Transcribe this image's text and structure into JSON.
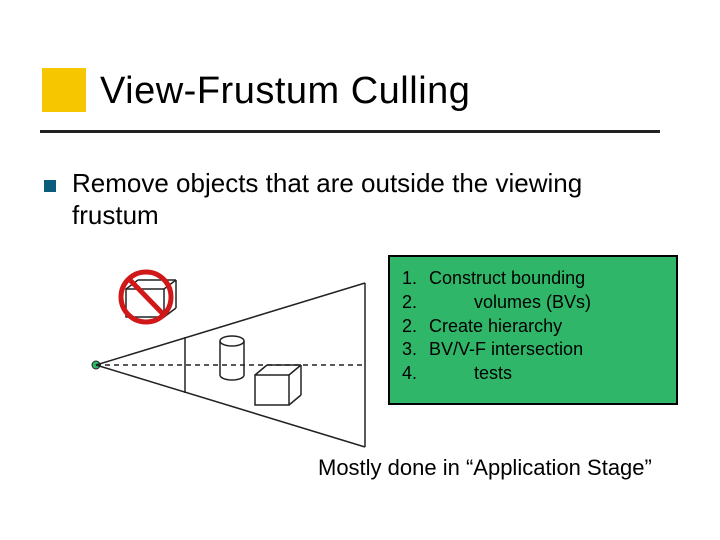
{
  "title": "View-Frustum Culling",
  "bullet": "Remove objects that are outside the viewing frustum",
  "steps": {
    "n1": "1.",
    "t1": "Construct bounding",
    "n2": "2.",
    "t2": "volumes (BVs)",
    "n3": "2.",
    "t3": "Create hierarchy",
    "n4": "3.",
    "t4": "BV/V-F intersection",
    "n5": "4.",
    "t5": "tests"
  },
  "footer": "Mostly done in “Application Stage”"
}
